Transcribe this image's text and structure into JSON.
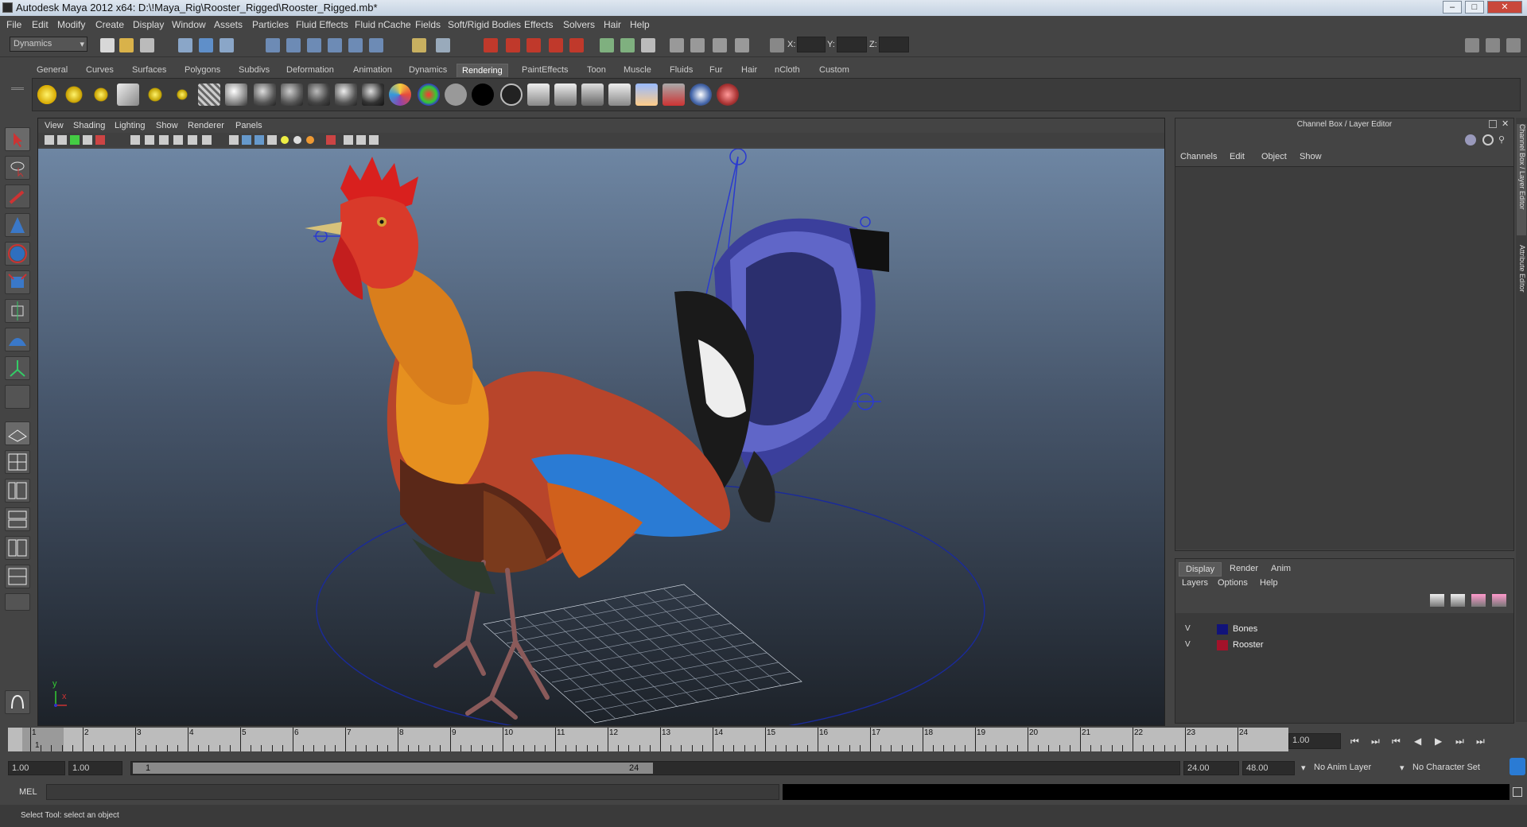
{
  "title": "Autodesk Maya 2012 x64: D:\\!Maya_Rig\\Rooster_Rigged\\Rooster_Rigged.mb*",
  "window_controls": {
    "minimize": "–",
    "maximize": "□",
    "close": "✕"
  },
  "menubar": [
    "File",
    "Edit",
    "Modify",
    "Create",
    "Display",
    "Window",
    "Assets",
    "Particles",
    "Fluid Effects",
    "Fluid nCache",
    "Fields",
    "Soft/Rigid Bodies",
    "Effects",
    "Solvers",
    "Hair",
    "Help"
  ],
  "status": {
    "menuset": "Dynamics",
    "x_label": "X:",
    "y_label": "Y:",
    "z_label": "Z:"
  },
  "shelf_tabs": [
    "General",
    "Curves",
    "Surfaces",
    "Polygons",
    "Subdivs",
    "Deformation",
    "Animation",
    "Dynamics",
    "Rendering",
    "PaintEffects",
    "Toon",
    "Muscle",
    "Fluids",
    "Fur",
    "Hair",
    "nCloth",
    "Custom"
  ],
  "active_shelf": "Rendering",
  "viewport": {
    "menu": [
      "View",
      "Shading",
      "Lighting",
      "Show",
      "Renderer",
      "Panels"
    ],
    "axis_y": "y",
    "axis_x": "x"
  },
  "channel_box": {
    "title": "Channel Box / Layer Editor",
    "menu": [
      "Channels",
      "Edit",
      "Object",
      "Show"
    ]
  },
  "side_tabs": [
    "Channel Box / Layer Editor",
    "Attribute Editor"
  ],
  "layer_editor": {
    "tabs": [
      "Display",
      "Render",
      "Anim"
    ],
    "menu": [
      "Layers",
      "Options",
      "Help"
    ],
    "layers": [
      {
        "visible": "V",
        "name": "Bones",
        "color": "#11137a"
      },
      {
        "visible": "V",
        "name": "Rooster",
        "color": "#a3122a"
      }
    ]
  },
  "timeline": {
    "frames": [
      "1",
      "2",
      "3",
      "4",
      "5",
      "6",
      "7",
      "8",
      "9",
      "10",
      "11",
      "12",
      "13",
      "14",
      "15",
      "16",
      "17",
      "18",
      "19",
      "20",
      "21",
      "22",
      "23",
      "24"
    ],
    "current_frame_marker": "1",
    "current_time": "1.00"
  },
  "playback": {
    "goto_start": "⏮",
    "step_back_key": "⏭",
    "step_back": "⏮",
    "play_back": "◀",
    "play": "▶",
    "step_fwd": "⏭",
    "goto_end": "⏭"
  },
  "range": {
    "start": "1.00",
    "playback_start": "1.00",
    "slider_start": "1",
    "slider_end": "24",
    "playback_end": "24.00",
    "end": "48.00",
    "anim_layer": "No Anim Layer",
    "character_set": "No Character Set"
  },
  "command": {
    "label": "MEL"
  },
  "help_line": "Select Tool: select an object"
}
